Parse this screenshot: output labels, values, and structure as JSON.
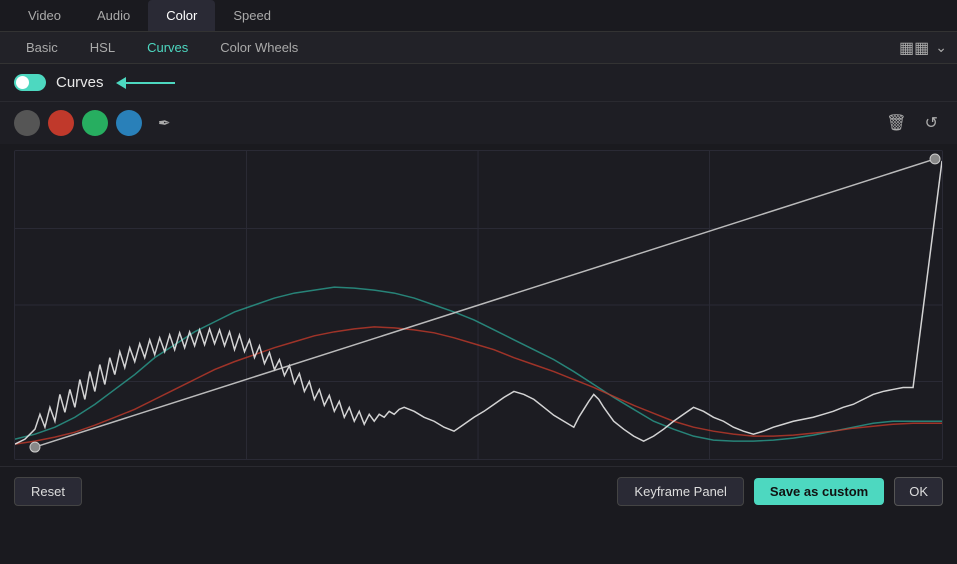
{
  "tabs": {
    "top": [
      {
        "id": "video",
        "label": "Video",
        "active": false
      },
      {
        "id": "audio",
        "label": "Audio",
        "active": false
      },
      {
        "id": "color",
        "label": "Color",
        "active": true
      },
      {
        "id": "speed",
        "label": "Speed",
        "active": false
      }
    ],
    "sub": [
      {
        "id": "basic",
        "label": "Basic",
        "active": false
      },
      {
        "id": "hsl",
        "label": "HSL",
        "active": false
      },
      {
        "id": "curves",
        "label": "Curves",
        "active": true
      },
      {
        "id": "color-wheels",
        "label": "Color Wheels",
        "active": false
      }
    ]
  },
  "curves": {
    "label": "Curves",
    "toggle_on": true,
    "channels": [
      {
        "id": "gray",
        "label": ""
      },
      {
        "id": "red",
        "label": ""
      },
      {
        "id": "green",
        "label": ""
      },
      {
        "id": "blue",
        "label": ""
      }
    ]
  },
  "toolbar": {
    "delete_tooltip": "Delete",
    "undo_tooltip": "Undo"
  },
  "footer": {
    "reset_label": "Reset",
    "keyframe_label": "Keyframe Panel",
    "save_custom_label": "Save as custom",
    "ok_label": "OK"
  },
  "icons": {
    "eyedropper": "✒",
    "delete": "🗑",
    "undo": "↺",
    "split_view": "⊞",
    "chevron": "∨"
  }
}
